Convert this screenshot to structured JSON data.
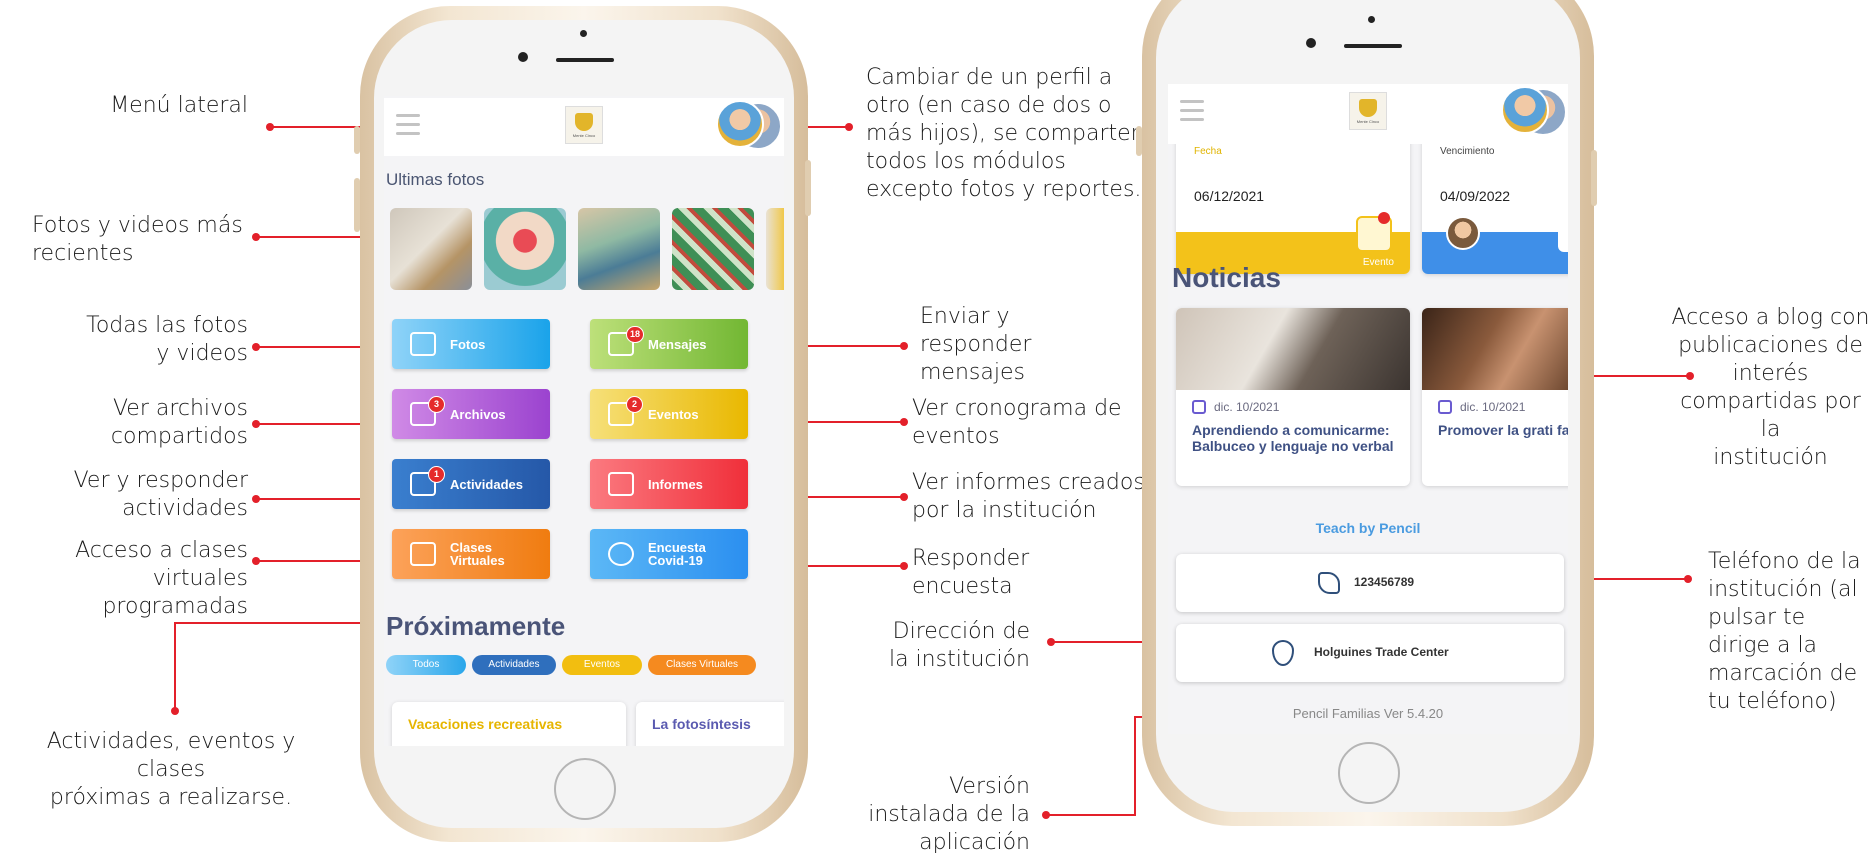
{
  "annotations": {
    "menu_lateral": "Menú lateral",
    "fotos_recientes": "Fotos y videos más\nrecientes",
    "todas_fotos": "Todas las fotos\ny videos",
    "archivos": "Ver archivos\ncompartidos",
    "actividades": "Ver y responder\nactividades",
    "clases": "Acceso a clases\nvirtuales programadas",
    "proximas": "Actividades, eventos y clases\npróximas a realizarse.",
    "perfil": "Cambiar de un perfil a\notro (en caso de dos o\nmás hijos), se comparten\ntodos los módulos\nexcepto  fotos y reportes.",
    "mensajes": "Enviar y\nresponder\nmensajes",
    "eventos": "Ver cronograma de\neventos",
    "informes": "Ver informes creados\npor la institución",
    "encuesta": "Responder\nencuesta",
    "direccion": "Dirección de\nla institución",
    "version": "Versión\ninstalada de la\naplicación",
    "blog": "Acceso a blog con\npublicaciones de\ninterés\ncompartidas por la\ninstitución",
    "telefono": "Teléfono de la\ninstitución (al\npulsar te\ndirige a la\nmarcación de\ntu teléfono)"
  },
  "phone1": {
    "logo_text": "Mente Cinco",
    "ultimas_fotos": "Ultimas fotos",
    "tiles": [
      {
        "label": "Fotos",
        "badge": ""
      },
      {
        "label": "Mensajes",
        "badge": "18"
      },
      {
        "label": "Archivos",
        "badge": "3"
      },
      {
        "label": "Eventos",
        "badge": "2"
      },
      {
        "label": "Actividades",
        "badge": "1"
      },
      {
        "label": "Informes",
        "badge": ""
      },
      {
        "label": "Clases\nVirtuales",
        "badge": ""
      },
      {
        "label": "Encuesta\nCovid-19",
        "badge": ""
      }
    ],
    "proximamente": "Próximamente",
    "filters": [
      "Todos",
      "Actividades",
      "Eventos",
      "Clases Virtuales"
    ],
    "upcoming": [
      "Vacaciones recreativas",
      "La fotosíntesis"
    ]
  },
  "phone2": {
    "logo_text": "Mente Cinco",
    "event_cards": [
      {
        "partial_label": "Fecha",
        "date": "06/12/2021",
        "type": "Evento"
      },
      {
        "partial_label": "Vencimiento",
        "date": "04/09/2022"
      }
    ],
    "noticias": "Noticias",
    "news": [
      {
        "date": "dic. 10/2021",
        "title": "Aprendiendo a comunicarme: Balbuceo y lenguaje no verbal"
      },
      {
        "date": "dic. 10/2021",
        "title": "Promover la grati familia"
      }
    ],
    "brand": "Teach by Pencil",
    "phone": "123456789",
    "address": "Holguines Trade Center",
    "version": "Pencil Familias Ver 5.4.20"
  },
  "colors": {
    "accent_red": "#e3202a",
    "fotos": "#3cb4f0",
    "mensajes": "#8cc63f",
    "archivos": "#b35fd6",
    "eventos": "#f2c200",
    "actividades": "#2f6fbd",
    "informes": "#f24b52",
    "clases": "#f58a1f",
    "encuesta": "#3a9ff0"
  }
}
